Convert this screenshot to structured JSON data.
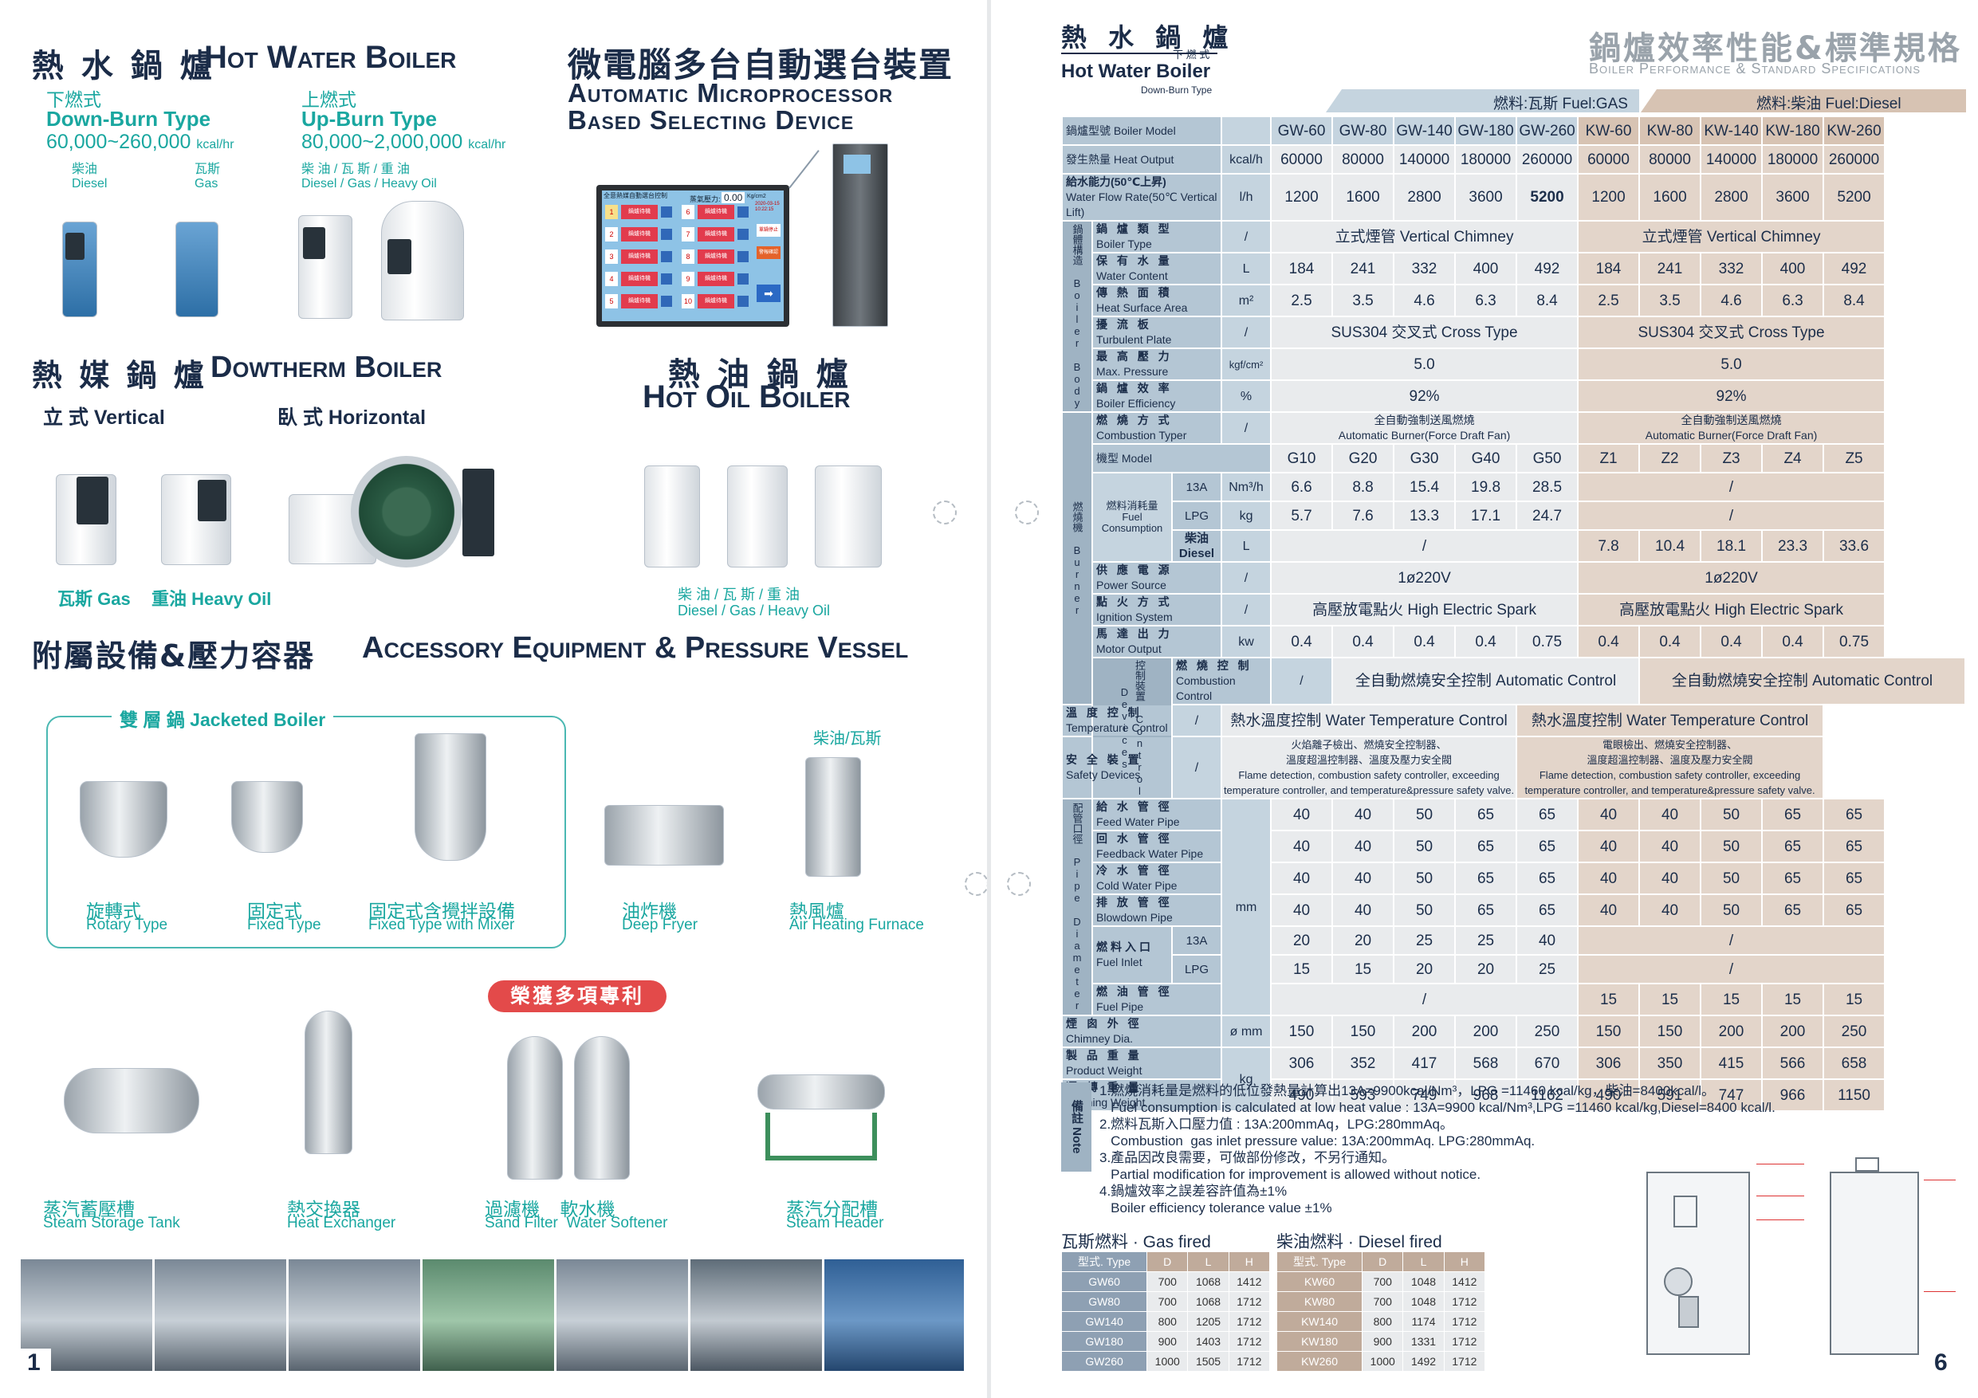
{
  "left": {
    "hot_water": {
      "title_cn": "熱 水 鍋 爐",
      "title_en": "Hot Water Boiler",
      "down_cn": "下燃式",
      "down_en": "Down-Burn Type",
      "down_range": "60,000~260,000",
      "unit": "kcal/hr",
      "up_cn": "上燃式",
      "up_en": "Up-Burn Type",
      "up_range": "80,000~2,000,000",
      "fuel1_cn": "柴油",
      "fuel1_en": "Diesel",
      "fuel2_cn": "瓦斯",
      "fuel2_en": "Gas",
      "fuel3_cn": "柴 油 / 瓦 斯 / 重 油",
      "fuel3_en": "Diesel / Gas / Heavy Oil"
    },
    "selector": {
      "title_cn": "微電腦多台自動選台裝置",
      "title_en1": "Automatic  Microprocessor",
      "title_en2": "Based  Selecting  Device",
      "screen_title": "全意熱媒自動選台控制",
      "screen_temp_label": "蒸氣壓力:",
      "screen_temp": "0.00",
      "screen_unit": "Kg/cm2",
      "screen_date": "2020-03-15",
      "screen_time": "10:22:15",
      "slots": [
        "1",
        "2",
        "3",
        "4",
        "5",
        "6",
        "7",
        "8",
        "9",
        "10"
      ],
      "slot_label": "鍋爐待機",
      "btn_stop": "單鍋停止",
      "btn_alarm": "警報確認"
    },
    "dowtherm": {
      "title_cn": "熱 媒 鍋 爐",
      "title_en": "Dowtherm Boiler",
      "vertical": "立 式  Vertical",
      "horizontal": "臥 式  Horizontal",
      "gas": "瓦斯 Gas",
      "heavy": "重油 Heavy Oil"
    },
    "hot_oil": {
      "title_cn": "熱 油 鍋 爐",
      "title_en": "Hot Oil Boiler",
      "fuel_cn": "柴 油 / 瓦 斯 / 重 油",
      "fuel_en": "Diesel / Gas / Heavy Oil"
    },
    "accessory": {
      "title_cn": "附屬設備&壓力容器",
      "title_en": "Accessory Equipment & Pressure Vessel",
      "jacketed": "雙 層 鍋 Jacketed Boiler",
      "fuel_tag": "柴油/瓦斯",
      "items": [
        {
          "cn": "旋轉式",
          "en": "Rotary Type"
        },
        {
          "cn": "固定式",
          "en": "Fixed Type"
        },
        {
          "cn": "固定式含攪拌設備",
          "en": "Fixed Type with Mixer"
        },
        {
          "cn": "油炸機",
          "en": "Deep Fryer"
        },
        {
          "cn": "熱風爐",
          "en": "Air Heating Furnace"
        }
      ],
      "patent": "榮獲多項專利",
      "vessels": [
        {
          "cn": "蒸汽蓄壓槽",
          "en": "Steam Storage Tank"
        },
        {
          "cn": "熱交換器",
          "en": "Heat Exchanger"
        },
        {
          "cn": "過濾機    軟水機",
          "en": "Sand Filter  Water Softener"
        },
        {
          "cn": "蒸汽分配槽",
          "en": "Steam Header"
        }
      ]
    },
    "page_number": "1"
  },
  "right": {
    "header": {
      "cn": "熱 水 鍋 爐",
      "sub_cn": "下 燃 式",
      "en": "Hot Water Boiler",
      "sub_en": "Down-Burn Type",
      "title_cn": "鍋爐效率性能&標準規格",
      "title_en": "Boiler Performance & Standard Specifications"
    },
    "fuel_gas": "燃料:瓦斯 Fuel:GAS",
    "fuel_diesel": "燃料:柴油 Fuel:Diesel",
    "models_gas": [
      "GW-60",
      "GW-80",
      "GW-140",
      "GW-180",
      "GW-260"
    ],
    "models_diesel": [
      "KW-60",
      "KW-80",
      "KW-140",
      "KW-180",
      "KW-260"
    ],
    "rows": {
      "model_label": "鍋爐型號 Boiler Model",
      "heat_output": {
        "label": "發生熱量 Heat Output",
        "unit": "kcal/h",
        "gas": [
          "60000",
          "80000",
          "140000",
          "180000",
          "260000"
        ],
        "diesel": [
          "60000",
          "80000",
          "140000",
          "180000",
          "260000"
        ]
      },
      "water_flow": {
        "label_cn": "給水能力(50℃上昇)",
        "label_en": "Water Flow Rate(50℃ Vertical Lift)",
        "unit": "l/h",
        "gas": [
          "1200",
          "1600",
          "2800",
          "3600",
          "5200"
        ],
        "diesel": [
          "1200",
          "1600",
          "2800",
          "3600",
          "5200"
        ]
      },
      "body_section": "鍋體構造 Boiler Body",
      "boiler_type": {
        "cn": "鍋 爐 類 型",
        "en": "Boiler Type",
        "unit": "/",
        "val": "立式煙管  Vertical Chimney"
      },
      "water_content": {
        "cn": "保 有 水 量",
        "en": "Water Content",
        "unit": "L",
        "gas": [
          "184",
          "241",
          "332",
          "400",
          "492"
        ],
        "diesel": [
          "184",
          "241",
          "332",
          "400",
          "492"
        ]
      },
      "heat_surface": {
        "cn": "傳 熱 面 積",
        "en": "Heat Surface Area",
        "unit": "m²",
        "gas": [
          "2.5",
          "3.5",
          "4.6",
          "6.3",
          "8.4"
        ],
        "diesel": [
          "2.5",
          "3.5",
          "4.6",
          "6.3",
          "8.4"
        ]
      },
      "turbulent": {
        "cn": "擾 流 板",
        "en": "Turbulent Plate",
        "unit": "/",
        "val": "SUS304  交叉式  Cross  Type"
      },
      "max_pressure": {
        "cn": "最 高 壓 力",
        "en": "Max.  Pressure",
        "unit": "kgf/cm²",
        "val": "5.0"
      },
      "efficiency": {
        "cn": "鍋 爐 效 率",
        "en": "Boiler Efficiency",
        "unit": "%",
        "val": "92%"
      },
      "burner_section": "燃燒機 Burner",
      "combustion_type": {
        "cn": "燃 燒 方 式",
        "en": "Combustion Typer",
        "unit": "/",
        "val1": "全自動強制送風燃燒",
        "val2": "Automatic Burner(Force Draft Fan)"
      },
      "burner_model": {
        "label": "機型 Model",
        "gas": [
          "G10",
          "G20",
          "G30",
          "G40",
          "G50"
        ],
        "diesel": [
          "Z1",
          "Z2",
          "Z3",
          "Z4",
          "Z5"
        ]
      },
      "fuel_consumption": {
        "cn": "燃料消耗量",
        "en": "Fuel Consumption",
        "lng_label": "13A",
        "lng_unit": "Nm³/h",
        "lng": [
          "6.6",
          "8.8",
          "15.4",
          "19.8",
          "28.5"
        ],
        "lpg_label": "LPG",
        "lpg_unit": "kg",
        "lpg": [
          "5.7",
          "7.6",
          "13.3",
          "17.1",
          "24.7"
        ],
        "diesel_label": "柴油  Diesel",
        "diesel_unit": "L",
        "diesel": [
          "7.8",
          "10.4",
          "18.1",
          "23.3",
          "33.6"
        ],
        "na": "/"
      },
      "power": {
        "cn": "供 應 電 源",
        "en": "Power Source",
        "unit": "/",
        "val": "1ø220V"
      },
      "ignition": {
        "cn": "點 火 方 式",
        "en": "Ignition System",
        "unit": "/",
        "val": "高壓放電點火  High  Electric  Spark"
      },
      "motor": {
        "cn": "馬 達 出 力",
        "en": "Motor Output",
        "unit": "kw",
        "gas": [
          "0.4",
          "0.4",
          "0.4",
          "0.4",
          "0.75"
        ],
        "diesel": [
          "0.4",
          "0.4",
          "0.4",
          "0.4",
          "0.75"
        ]
      },
      "control_section": "控制裝置 Control Devices",
      "combustion_ctrl": {
        "cn": "燃 燒 控 制",
        "en": "Combustion  Control",
        "unit": "/",
        "val": "全自動燃燒安全控制  Automatic  Control"
      },
      "temp_ctrl": {
        "cn": "溫 度 控 制",
        "en": "Temperature Control",
        "unit": "/",
        "val": "熱水溫度控制  Water  Temperature  Control"
      },
      "safety": {
        "cn": "安 全 裝 置",
        "en": "Safety Devices",
        "unit": "/",
        "gas1": "火焰離子檢出、燃燒安全控制器、",
        "gas2": "溫度超溫控制器、溫度及壓力安全閥",
        "gas3": "Flame detection, combustion safety controller, exceeding",
        "gas4": "temperature controller, and temperature&pressure safety valve.",
        "dsl1": "電眼檢出、燃燒安全控制器、",
        "dsl2": "溫度超溫控制器、溫度及壓力安全閥",
        "dsl3": "Flame detection, combustion safety controller, exceeding",
        "dsl4": "temperature controller, and temperature&pressure safety valve."
      },
      "pipe_section": "配管口徑 Pipe Diameter",
      "pipe_unit": "mm",
      "feed_water": {
        "cn": "給 水 管 徑",
        "en": "Feed Water Pipe",
        "gas": [
          "40",
          "40",
          "50",
          "65",
          "65"
        ],
        "diesel": [
          "40",
          "40",
          "50",
          "65",
          "65"
        ]
      },
      "feedback": {
        "cn": "回 水 管 徑",
        "en": "Feedback Water Pipe",
        "gas": [
          "40",
          "40",
          "50",
          "65",
          "65"
        ],
        "diesel": [
          "40",
          "40",
          "50",
          "65",
          "65"
        ]
      },
      "cold_water": {
        "cn": "冷 水 管 徑",
        "en": "Cold Water Pipe",
        "gas": [
          "40",
          "40",
          "50",
          "65",
          "65"
        ],
        "diesel": [
          "40",
          "40",
          "50",
          "65",
          "65"
        ]
      },
      "blowdown": {
        "cn": "排 放 管 徑",
        "en": "Blowdown Pipe",
        "gas": [
          "40",
          "40",
          "50",
          "65",
          "65"
        ],
        "diesel": [
          "40",
          "40",
          "50",
          "65",
          "65"
        ]
      },
      "fuel_inlet": {
        "cn": "燃料入口",
        "en": "Fuel Inlet",
        "a_label": "13A",
        "a": [
          "20",
          "20",
          "25",
          "25",
          "40"
        ],
        "b_label": "LPG",
        "b": [
          "15",
          "15",
          "20",
          "20",
          "25"
        ],
        "na": "/"
      },
      "fuel_pipe": {
        "cn": "燃 油 管 徑",
        "en": "Fuel Pipe",
        "na": "/",
        "diesel": [
          "15",
          "15",
          "15",
          "15",
          "15"
        ]
      },
      "chimney": {
        "cn": "煙 囪 外 徑",
        "en": "Chimney Dia.",
        "unit": "ø mm",
        "gas": [
          "150",
          "150",
          "200",
          "200",
          "250"
        ],
        "diesel": [
          "150",
          "150",
          "200",
          "200",
          "250"
        ]
      },
      "product_weight": {
        "cn": "製 品 重 量",
        "en": "Product Weight",
        "unit": "kg",
        "gas": [
          "306",
          "352",
          "417",
          "568",
          "670"
        ],
        "diesel": [
          "306",
          "350",
          "415",
          "566",
          "658"
        ]
      },
      "running_weight": {
        "cn": "運 轉 重 量",
        "en": "Running Weight",
        "gas": [
          "490",
          "593",
          "749",
          "968",
          "1162"
        ],
        "diesel": [
          "490",
          "591",
          "747",
          "966",
          "1150"
        ]
      }
    },
    "notes": {
      "label": "備註 Note",
      "lines": [
        "1.燃燒消耗量是燃料的低位發熱量計算出13A=9900kcal/Nm³，LPG =11460 kcal/kg，柴油=8400kcal/l。",
        "   Fuel consumption is calculated at low heat value : 13A=9900 kcal/Nm³,LPG =11460 kcal/kg,Diesel=8400 kcal/l.",
        "2.燃料瓦斯入口壓力值 : 13A:200mmAq，LPG:280mmAq。",
        "   Combustion  gas inlet pressure value: 13A:200mmAq. LPG:280mmAq.",
        "3.產品因改良需要，可做部份修改，不另行通知。",
        "   Partial modification for improvement is allowed without notice.",
        "4.鍋爐效率之誤差容許值為±1%",
        "   Boiler efficiency tolerance value ±1%"
      ]
    },
    "gas_dims": {
      "title": "瓦斯燃料 · Gas fired",
      "head": [
        "型式. Type",
        "D",
        "L",
        "H"
      ],
      "rows": [
        [
          "GW60",
          "700",
          "1068",
          "1412"
        ],
        [
          "GW80",
          "700",
          "1068",
          "1712"
        ],
        [
          "GW140",
          "800",
          "1205",
          "1712"
        ],
        [
          "GW180",
          "900",
          "1403",
          "1712"
        ],
        [
          "GW260",
          "1000",
          "1505",
          "1712"
        ]
      ]
    },
    "diesel_dims": {
      "title": "柴油燃料 · Diesel fired",
      "head": [
        "型式. Type",
        "D",
        "L",
        "H"
      ],
      "rows": [
        [
          "KW60",
          "700",
          "1048",
          "1412"
        ],
        [
          "KW80",
          "700",
          "1048",
          "1712"
        ],
        [
          "KW140",
          "800",
          "1174",
          "1712"
        ],
        [
          "KW180",
          "900",
          "1331",
          "1712"
        ],
        [
          "KW260",
          "1000",
          "1492",
          "1712"
        ]
      ]
    },
    "page_number": "6",
    "colors": {
      "gas": "#e9ebed",
      "diesel": "#e3d5ca",
      "label": "#b4c6d4",
      "teal": "#1aa7a0",
      "navy": "#1b2c48"
    }
  }
}
